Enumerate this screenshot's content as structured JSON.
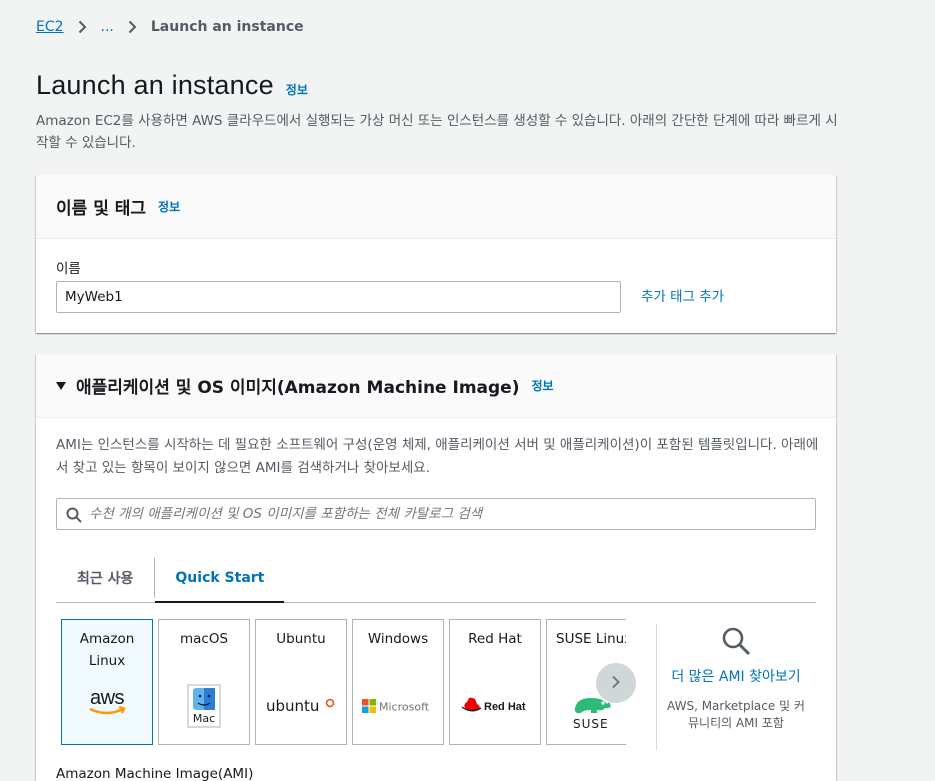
{
  "breadcrumb": {
    "root": "EC2",
    "ellipsis": "...",
    "current": "Launch an instance"
  },
  "page": {
    "title": "Launch an instance",
    "info": "정보",
    "description": "Amazon EC2를 사용하면 AWS 클라우드에서 실행되는 가상 머신 또는 인스턴스를 생성할 수 있습니다. 아래의 간단한 단계에 따라 빠르게 시작할 수 있습니다."
  },
  "name_tags": {
    "title": "이름 및 태그",
    "info": "정보",
    "name_label": "이름",
    "name_value": "MyWeb1",
    "add_tag": "추가 태그 추가"
  },
  "ami": {
    "title": "애플리케이션 및 OS 이미지(Amazon Machine Image)",
    "info": "정보",
    "description": "AMI는 인스턴스를 시작하는 데 필요한 소프트웨어 구성(운영 체제, 애플리케이션 서버 및 애플리케이션)이 포함된 템플릿입니다. 아래에서 찾고 있는 항목이 보이지 않으면 AMI를 검색하거나 찾아보세요.",
    "search_placeholder": "수천 개의 애플리케이션 및 OS 이미지를 포함하는 전체 카탈로그 검색",
    "tabs": [
      "최근 사용",
      "Quick Start"
    ],
    "active_tab": "Quick Start",
    "os_cards": [
      {
        "name": "Amazon Linux",
        "logo": "aws-logo",
        "selected": true
      },
      {
        "name": "macOS",
        "logo": "finder-logo",
        "logo_text": "Mac"
      },
      {
        "name": "Ubuntu",
        "logo": "ubuntu-logo",
        "logo_text": "ubuntu"
      },
      {
        "name": "Windows",
        "logo": "microsoft-logo",
        "logo_text": "Microsoft"
      },
      {
        "name": "Red Hat",
        "logo": "redhat-logo",
        "logo_text": "Red Hat"
      },
      {
        "name": "SUSE Linux",
        "logo": "suse-logo",
        "logo_text": "SUSE"
      }
    ],
    "more_link": "더 많은 AMI 찾아보기",
    "more_sub": "AWS, Marketplace 및 커뮤니티의 AMI 포함",
    "ami_label": "Amazon Machine Image(AMI)"
  },
  "colors": {
    "link": "#0073bb",
    "aws_orange": "#ff9900",
    "ubuntu_orange": "#e95420",
    "redhat_red": "#ee0000",
    "suse_green": "#30ba78"
  }
}
